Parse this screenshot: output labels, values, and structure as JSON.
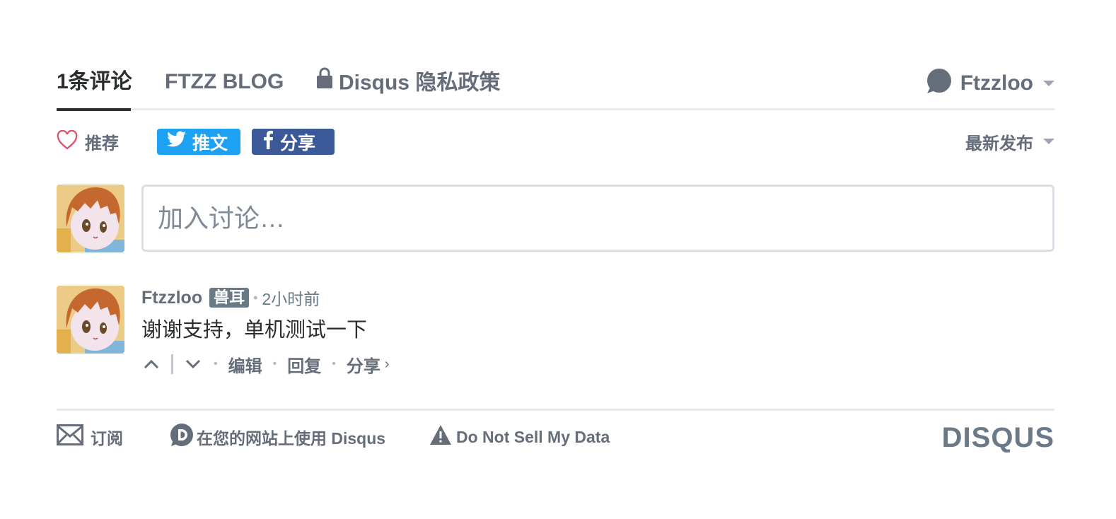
{
  "nav": {
    "tab_comments": "1条评论",
    "tab_blog": "FTZZ BLOG",
    "tab_privacy": "Disqus 隐私政策",
    "user_name": "Ftzzloo"
  },
  "actions": {
    "recommend_label": "推荐",
    "tweet_label": "推文",
    "share_label": "分享",
    "sort_label": "最新发布"
  },
  "composer": {
    "placeholder": "加入讨论…"
  },
  "comment": {
    "author": "Ftzzloo",
    "badge": "兽耳",
    "time": "2小时前",
    "body": "谢谢支持，单机测试一下",
    "edit": "编辑",
    "reply": "回复",
    "share": "分享",
    "share_chevron": "›"
  },
  "footer": {
    "subscribe": "订阅",
    "add_disqus": "在您的网站上使用 Disqus",
    "do_not_sell": "Do Not Sell My Data",
    "logo": "DISQUS"
  },
  "colors": {
    "text_dark": "#2a2e2e",
    "text_muted": "#656c7a",
    "twitter": "#1da1f2",
    "facebook": "#3b5998",
    "heart": "#e0556a",
    "badge": "#687a86"
  },
  "icons": [
    "lock-icon",
    "chat-bubble-icon",
    "heart-icon",
    "twitter-icon",
    "facebook-icon",
    "chevron-up-icon",
    "chevron-down-icon",
    "envelope-icon",
    "disqus-d-icon",
    "warning-icon"
  ]
}
